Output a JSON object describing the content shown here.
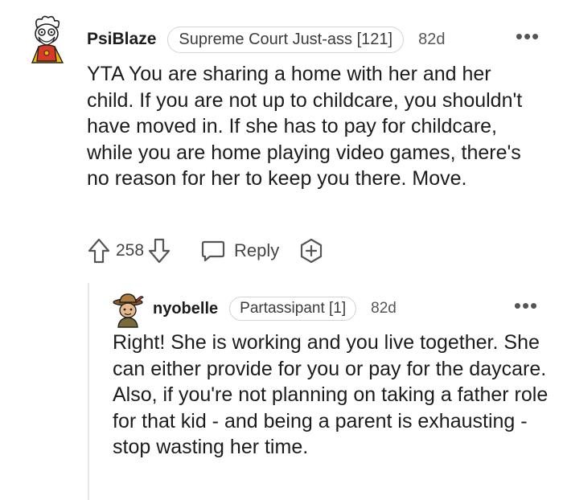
{
  "comments": [
    {
      "username": "PsiBlaze",
      "flair": "Supreme Court Just-ass [121]",
      "time": "82d",
      "more": "•••",
      "avatar_icon": "scientist-avatar-icon",
      "body": "YTA You are sharing a home with her and her child. If you are not up to childcare, you shouldn't have moved in. If she has to pay for childcare, while you are home playing video games, there's no reason for her to keep you there. Move.",
      "score": "258",
      "reply_label": "Reply"
    },
    {
      "username": "nyobelle",
      "flair": "Partassipant [1]",
      "time": "82d",
      "more": "•••",
      "avatar_icon": "explorer-avatar-icon",
      "body": "Right! She is working and you live together. She can either provide for you or pay for the daycare. Also, if you're not planning on taking a father role for that kid - and being a parent is exhausting - stop wasting her time."
    }
  ],
  "colors": {
    "text": "#1c1c1c",
    "muted": "#555555",
    "border": "#d4d4d4",
    "thread_line": "#e6e6e6",
    "avatar_red": "#d93a25",
    "avatar_yellow": "#f2b705"
  }
}
